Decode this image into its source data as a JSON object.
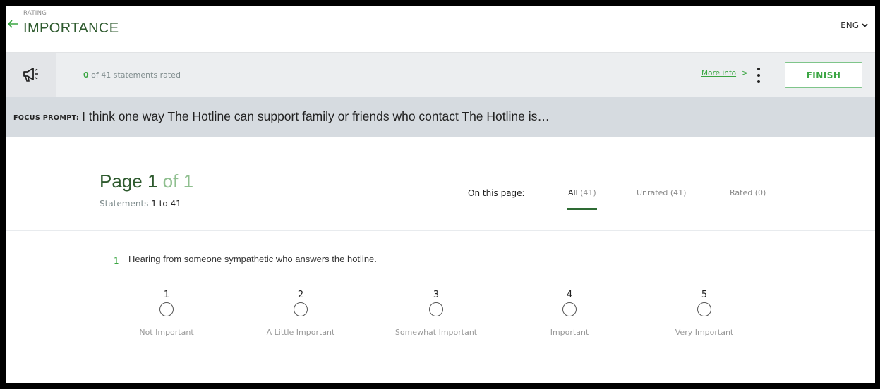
{
  "header": {
    "subtitle": "RATING",
    "title": "IMPORTANCE",
    "language": "ENG"
  },
  "toolbar": {
    "rated_count": "0",
    "rated_suffix": "of 41 statements rated",
    "more_info": "More info",
    "more_info_chevron": ">",
    "finish_label": "FINISH"
  },
  "focus": {
    "label": "FOCUS PROMPT:",
    "text": "I think one way The Hotline can support family or friends who contact The Hotline is…"
  },
  "page": {
    "page_word": "Page",
    "page_num": "1",
    "of_total": "of 1",
    "statements_word": "Statements",
    "statements_range": "1 to 41",
    "on_this_page": "On this page:",
    "tabs": [
      {
        "label": "All",
        "count": "(41)"
      },
      {
        "label": "Unrated (41)"
      },
      {
        "label": "Rated (0)"
      }
    ]
  },
  "statement": {
    "number": "1",
    "text": "Hearing from someone sympathetic who answers the hotline.",
    "options": [
      {
        "value": "1",
        "label": "Not Important"
      },
      {
        "value": "2",
        "label": "A Little Important"
      },
      {
        "value": "3",
        "label": "Somewhat Important"
      },
      {
        "value": "4",
        "label": "Important"
      },
      {
        "value": "5",
        "label": "Very Important"
      }
    ]
  },
  "colors": {
    "accent_green": "#3aa542",
    "dark_green": "#2e5a2e",
    "toolbar_bg": "#eceef0",
    "focus_bg": "#d6dbe0"
  }
}
